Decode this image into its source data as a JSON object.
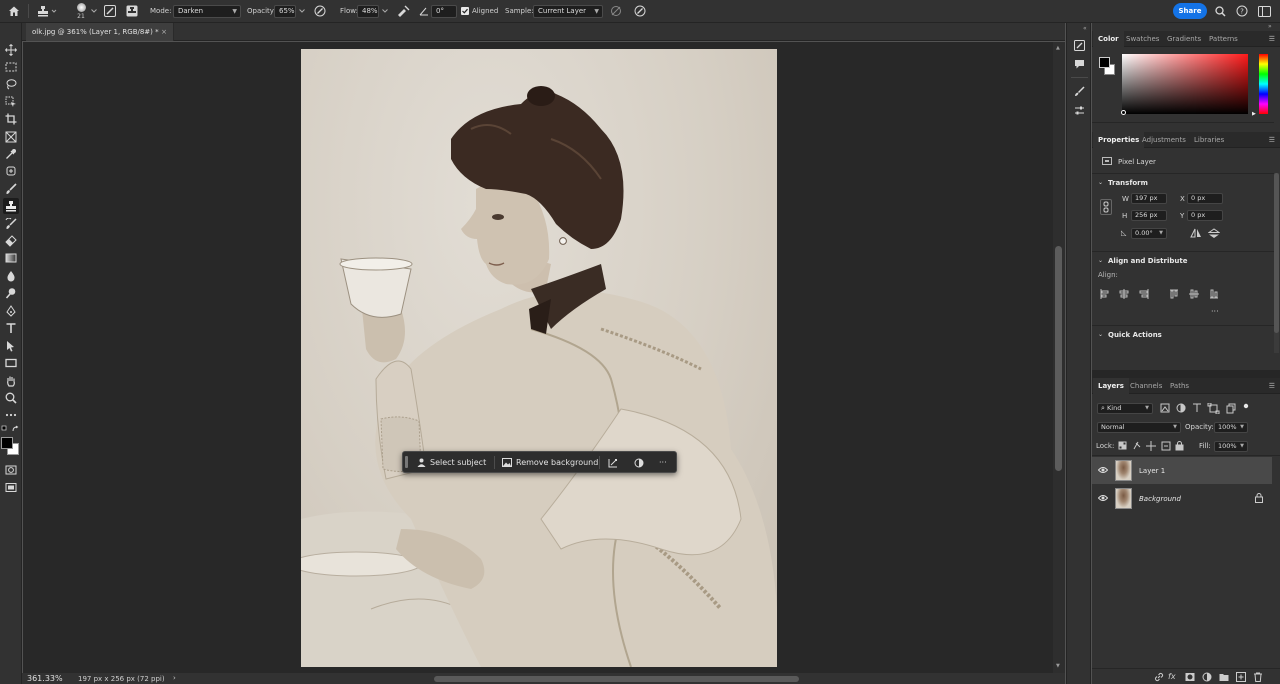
{
  "options_bar": {
    "brush_size": "21",
    "mode_label": "Mode:",
    "mode_value": "Darken",
    "opacity_label": "Opacity:",
    "opacity_value": "65%",
    "flow_label": "Flow:",
    "flow_value": "48%",
    "angle_value": "0°",
    "aligned_label": "Aligned",
    "sample_label": "Sample:",
    "sample_value": "Current Layer",
    "share_label": "Share"
  },
  "document": {
    "tab_title": "olk.jpg @ 361% (Layer 1, RGB/8#) *",
    "close_glyph": "×"
  },
  "status_bar": {
    "zoom": "361.33%",
    "doc_info": "197 px x 256 px (72 ppi)",
    "arrow": "›"
  },
  "context_bar": {
    "select_subject": "Select subject",
    "remove_background": "Remove background",
    "more": "···"
  },
  "color_panel": {
    "tabs": [
      "Color",
      "Swatches",
      "Gradients",
      "Patterns"
    ],
    "foreground": "#000000",
    "background": "#ffffff",
    "hue_color": "#ff1a1a"
  },
  "properties_panel": {
    "tabs": [
      "Properties",
      "Adjustments",
      "Libraries"
    ],
    "layer_kind": "Pixel Layer",
    "transform_title": "Transform",
    "w_label": "W",
    "w_value": "197 px",
    "h_label": "H",
    "h_value": "256 px",
    "x_label": "X",
    "x_value": "0 px",
    "y_label": "Y",
    "y_value": "0 px",
    "angle_value": "0.00°",
    "align_title": "Align and Distribute",
    "align_label": "Align:",
    "align_more": "···",
    "quick_actions_title": "Quick Actions"
  },
  "layers_panel": {
    "tabs": [
      "Layers",
      "Channels",
      "Paths"
    ],
    "filter_kind": "Kind",
    "blend_mode": "Normal",
    "opacity_label": "Opacity:",
    "opacity_value": "100%",
    "lock_label": "Lock:",
    "fill_label": "Fill:",
    "fill_value": "100%",
    "layers": [
      {
        "name": "Layer 1",
        "selected": true
      },
      {
        "name": "Background",
        "selected": false,
        "locked": true
      }
    ],
    "footer_fx": "fx"
  },
  "accent_color": "#1473e6"
}
